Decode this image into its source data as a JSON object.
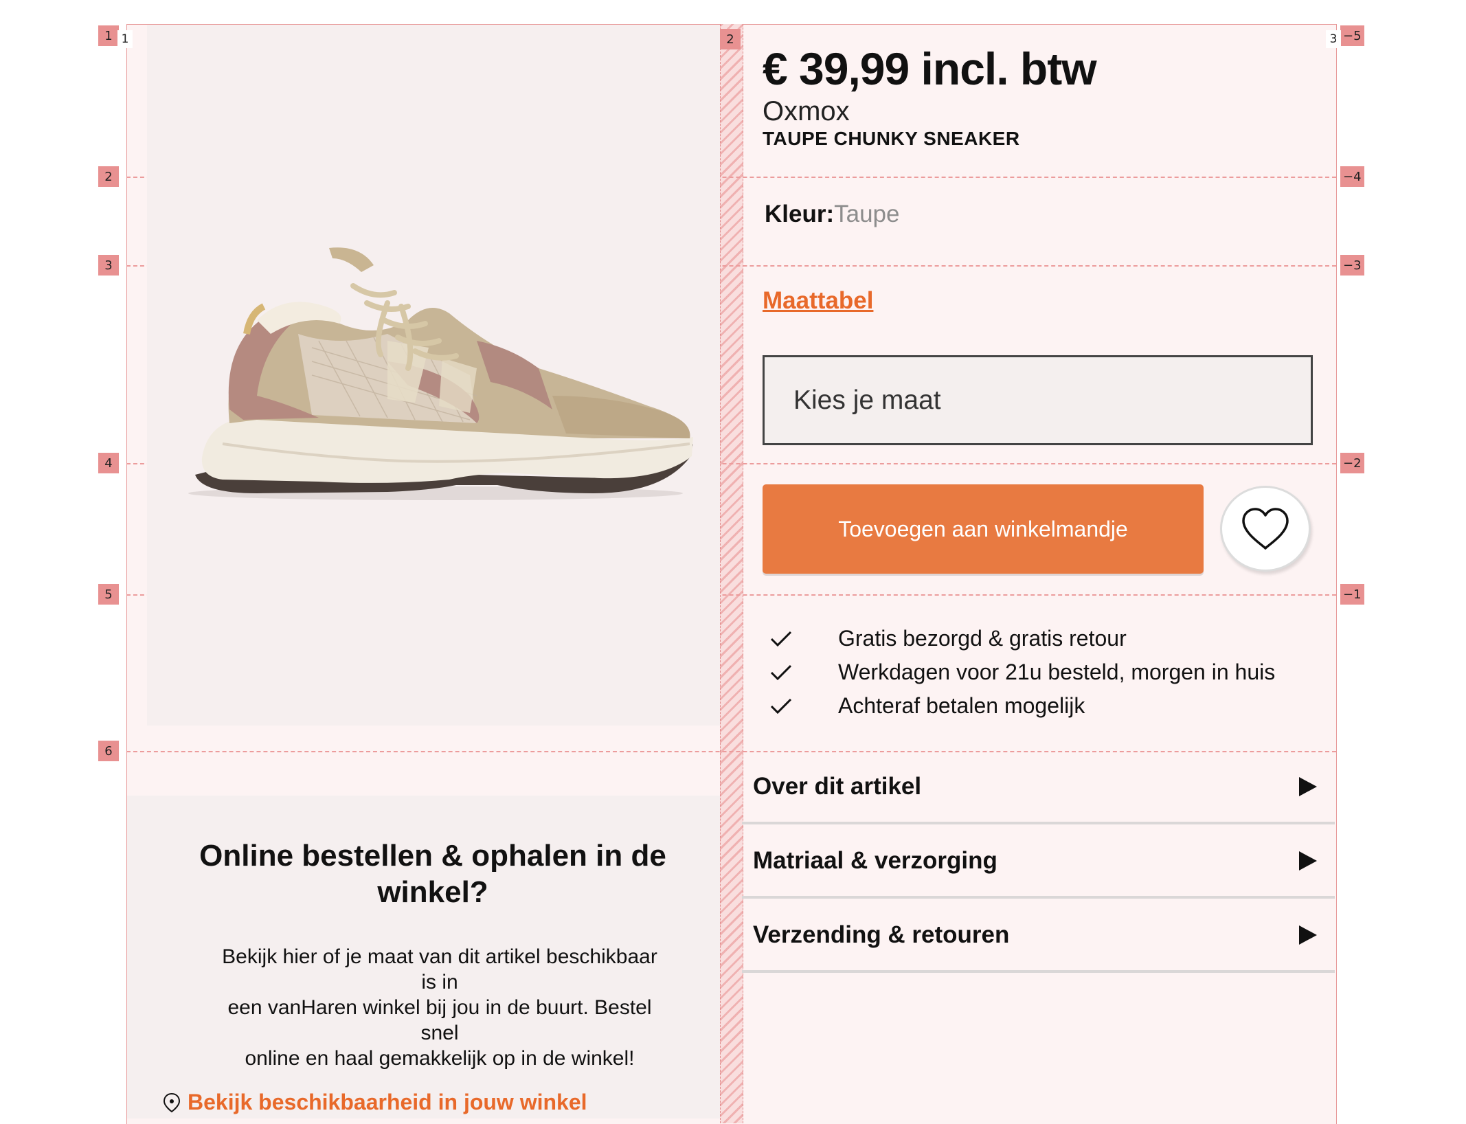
{
  "grid": {
    "left_markers": [
      "1",
      "2",
      "3",
      "4",
      "5",
      "6"
    ],
    "right_markers": [
      "−5",
      "−4",
      "−3",
      "−2",
      "−1"
    ],
    "column_markers": [
      "1",
      "2",
      "3"
    ]
  },
  "product": {
    "price": "€ 39,99 incl. btw",
    "brand": "Oxmox",
    "name": "TAUPE CHUNKY SNEAKER",
    "color_label": "Kleur:",
    "color_value": "Taupe",
    "size_chart_link": "Maattabel",
    "size_select_placeholder": "Kies je maat",
    "add_to_cart_label": "Toevoegen aan winkelmandje"
  },
  "usps": [
    "Gratis bezorgd & gratis retour",
    "Werkdagen voor 21u besteld, morgen in huis",
    "Achteraf betalen mogelijk"
  ],
  "accordion": [
    "Over dit artikel",
    "Matriaal & verzorging",
    "Verzending & retouren"
  ],
  "pickup": {
    "title": "Online bestellen & ophalen in de winkel?",
    "body_lines": [
      "Bekijk hier of je maat van dit artikel beschikbaar",
      "is in",
      "een vanHaren winkel bij jou in de buurt. Bestel",
      "snel",
      "online en haal gemakkelijk op in de winkel!"
    ],
    "link": "Bekijk beschikbaarheid in jouw winkel"
  },
  "colors": {
    "accent": "#e8692a",
    "button": "#e87a41",
    "grid_line": "#ec9c9c",
    "grid_bg": "#fdf3f3"
  },
  "icons": {
    "favorite": "heart-icon",
    "usp": "check-icon",
    "accordion": "triangle-right-icon",
    "store": "location-pin-icon"
  }
}
